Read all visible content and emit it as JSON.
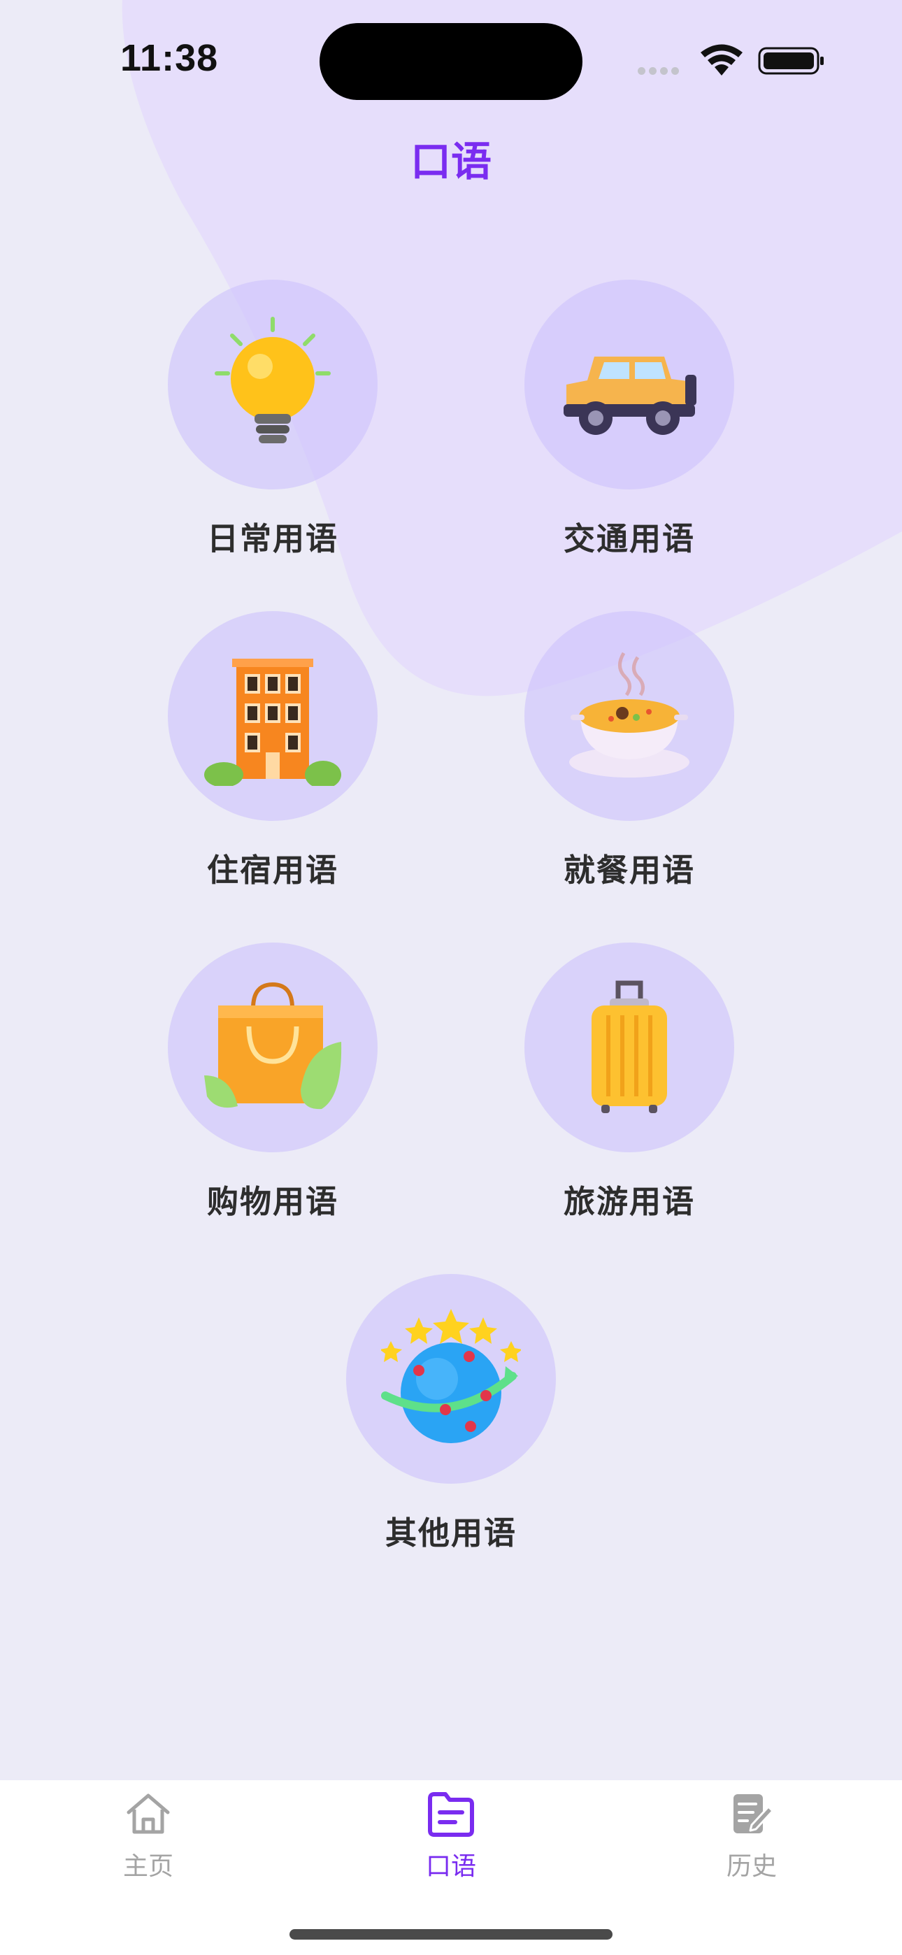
{
  "status_bar": {
    "time": "11:38"
  },
  "header": {
    "title": "口语"
  },
  "categories": [
    {
      "label": "日常用语",
      "icon": "lightbulb-icon"
    },
    {
      "label": "交通用语",
      "icon": "jeep-icon"
    },
    {
      "label": "住宿用语",
      "icon": "hotel-building-icon"
    },
    {
      "label": "就餐用语",
      "icon": "soup-bowl-icon"
    },
    {
      "label": "购物用语",
      "icon": "shopping-bag-icon"
    },
    {
      "label": "旅游用语",
      "icon": "suitcase-icon"
    },
    {
      "label": "其他用语",
      "icon": "globe-stars-icon"
    }
  ],
  "tab_bar": {
    "tabs": [
      {
        "label": "主页",
        "icon": "home-icon",
        "active": false
      },
      {
        "label": "口语",
        "icon": "document-icon",
        "active": true
      },
      {
        "label": "历史",
        "icon": "history-edit-icon",
        "active": false
      }
    ]
  },
  "colors": {
    "accent": "#7a2cf0",
    "background": "#ecebf7",
    "icon_circle": "#d8d2fb",
    "tab_inactive": "#a4a4a4"
  }
}
